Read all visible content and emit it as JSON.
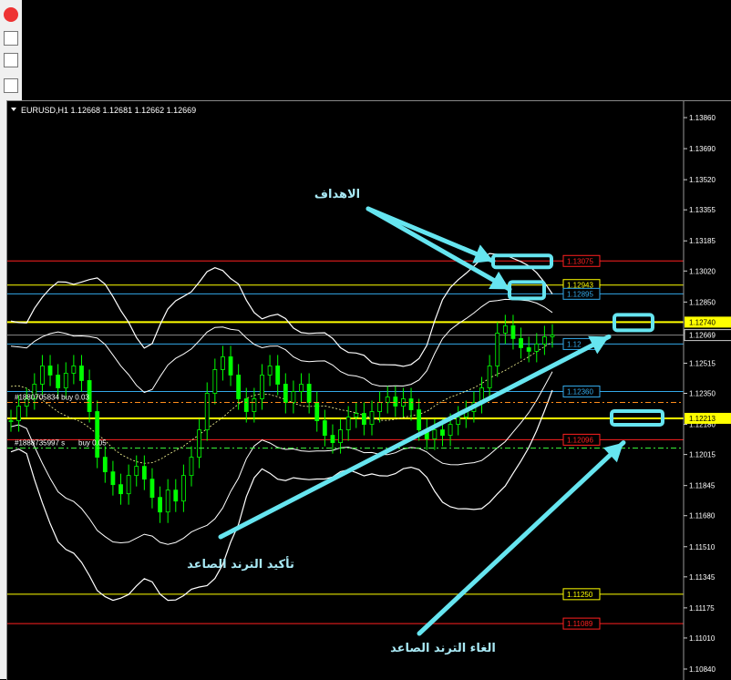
{
  "window": {
    "header": "EURUSD,H1  1.12668 1.12681 1.12662 1.12669"
  },
  "colors": {
    "background": "#000000",
    "candle": "#00ff00",
    "axis_text": "#ffffff",
    "arrow": "#66e5f0",
    "red_line": "#ff2020",
    "yellow_line": "#ffff00",
    "blue_line": "#33a8e8",
    "orange_line": "#ff8c1a",
    "bollinger": "#ffffff"
  },
  "chart_data": {
    "type": "line",
    "symbol": "EURUSD",
    "timeframe": "H1",
    "ohlc": {
      "open": 1.12668,
      "high": 1.12681,
      "low": 1.12662,
      "close": 1.12669
    },
    "y_ticks": [
      "1.13860",
      "1.13690",
      "1.13520",
      "1.13355",
      "1.13185",
      "1.13020",
      "1.12850",
      "1.12680",
      "1.12515",
      "1.12350",
      "1.12180",
      "1.12015",
      "1.11845",
      "1.11680",
      "1.11510",
      "1.11345",
      "1.11175",
      "1.11010",
      "1.10840"
    ],
    "ylim": [
      1.1078,
      1.1395
    ],
    "current_price": "1.12669",
    "levels": [
      {
        "label": "1.13075",
        "value": 1.13075,
        "color": "#ff2020"
      },
      {
        "label": "1.12943",
        "value": 1.12943,
        "color": "#ffff00"
      },
      {
        "label": "1.12895",
        "value": 1.12895,
        "color": "#33a8e8"
      },
      {
        "label": "1.12740",
        "value": 1.1274,
        "color": "#ffff00",
        "highlight": true
      },
      {
        "label": "1.12",
        "value": 1.1262,
        "color": "#33a8e8"
      },
      {
        "label": "1.12360",
        "value": 1.1236,
        "color": "#33a8e8"
      },
      {
        "label": "1.12213",
        "value": 1.12213,
        "color": "#ffff00",
        "highlight": true
      },
      {
        "label": "1.12096",
        "value": 1.12096,
        "color": "#ff2020"
      },
      {
        "label": "1.11250",
        "value": 1.1125,
        "color": "#ffff00"
      },
      {
        "label": "1.11089",
        "value": 1.11089,
        "color": "#ff2020"
      }
    ],
    "orders": [
      {
        "label": "#1880705834 buy 0.03",
        "value": 1.123
      },
      {
        "label": "#1888735997 s",
        "value": 1.1205
      },
      {
        "label": "buy 0.05",
        "value": 1.1205
      }
    ],
    "price_series": [
      1.122,
      1.1228,
      1.1232,
      1.124,
      1.125,
      1.1245,
      1.1238,
      1.1246,
      1.125,
      1.1242,
      1.1225,
      1.12,
      1.1192,
      1.1185,
      1.118,
      1.119,
      1.1195,
      1.1188,
      1.1178,
      1.117,
      1.1182,
      1.1176,
      1.119,
      1.12,
      1.1215,
      1.1235,
      1.1248,
      1.1255,
      1.1245,
      1.1232,
      1.1225,
      1.1232,
      1.1245,
      1.125,
      1.124,
      1.123,
      1.1236,
      1.124,
      1.123,
      1.122,
      1.1212,
      1.1208,
      1.1215,
      1.1222,
      1.1224,
      1.1218,
      1.1225,
      1.123,
      1.1233,
      1.1228,
      1.1232,
      1.1226,
      1.1215,
      1.121,
      1.1215,
      1.1212,
      1.1218,
      1.1222,
      1.1225,
      1.123,
      1.1238,
      1.125,
      1.1268,
      1.1272,
      1.1265,
      1.126,
      1.1258,
      1.1262,
      1.1266,
      1.12669
    ]
  },
  "annotations": {
    "targets": "الاهداف",
    "confirm_uptrend": "تأكيد الترند الصاعد",
    "cancel_uptrend": "الغاء الترند الصاعد"
  }
}
